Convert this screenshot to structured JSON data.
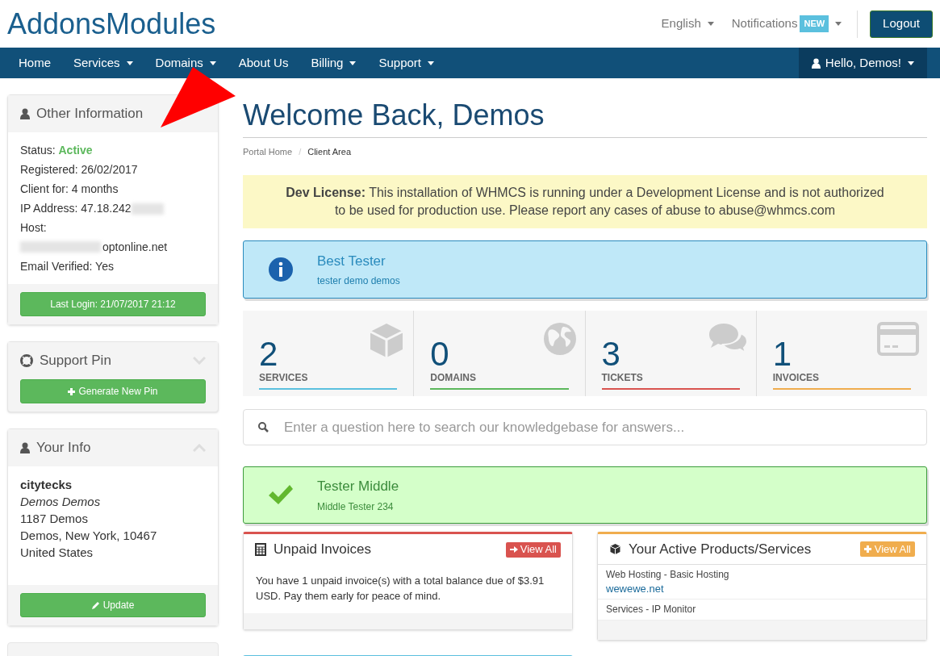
{
  "header": {
    "logo": "AddonsModules",
    "language": "English",
    "notifications": {
      "label": "Notifications",
      "badge": "NEW"
    },
    "logout": "Logout"
  },
  "nav": {
    "items": [
      {
        "label": "Home",
        "dropdown": false
      },
      {
        "label": "Services",
        "dropdown": true
      },
      {
        "label": "Domains",
        "dropdown": true
      },
      {
        "label": "About Us",
        "dropdown": false
      },
      {
        "label": "Billing",
        "dropdown": true
      },
      {
        "label": "Support",
        "dropdown": true
      }
    ],
    "user_menu": "Hello, Demos!"
  },
  "sidebar": {
    "other_information": {
      "title": "Other Information",
      "lines": [
        {
          "kind": "status",
          "label": "Status:",
          "value": "Active"
        },
        {
          "kind": "plain",
          "label": "Registered: 26/02/2017"
        },
        {
          "kind": "plain",
          "label": "Client for: 4 months"
        },
        {
          "kind": "redacted_after",
          "label": "IP Address: 47.18.242"
        },
        {
          "kind": "plain",
          "label": "Host:"
        },
        {
          "kind": "redacted_before",
          "label": "optonline.net"
        },
        {
          "kind": "plain",
          "label": "Email Verified: Yes"
        }
      ],
      "button": "Last Login: 21/07/2017 21:12"
    },
    "support_pin": {
      "title": "Support Pin",
      "collapsed": true,
      "button": "Generate New Pin"
    },
    "your_info": {
      "title": "Your Info",
      "collapsed": false,
      "username": "citytecks",
      "name": "Demos Demos",
      "address": [
        "1187 Demos",
        "Demos, New York, 10467",
        "United States"
      ],
      "button": "Update"
    }
  },
  "main": {
    "title": "Welcome Back, Demos",
    "breadcrumb_separator": "/",
    "breadcrumb": [
      {
        "label": "Portal Home",
        "selected": false
      },
      {
        "label": "Client Area",
        "selected": true
      }
    ],
    "license_alert": "**Dev License:** This installation of WHMCS is running under a Development License and is not authorized to be used for production use. Please report any cases of abuse to abuse@whmcs.com",
    "info_banner": {
      "title": "Best Tester",
      "subtitle": "tester demo demos"
    },
    "stats": [
      {
        "kind": "box",
        "count": "2",
        "label": "SERVICES",
        "color": "#5bc0de"
      },
      {
        "kind": "globe",
        "count": "0",
        "label": "DOMAINS",
        "color": "#5cb85c"
      },
      {
        "kind": "chat",
        "count": "3",
        "label": "TICKETS",
        "color": "#d9534f"
      },
      {
        "kind": "card",
        "count": "1",
        "label": "INVOICES",
        "color": "#f0ad4e"
      }
    ],
    "search": {
      "placeholder": "Enter a question here to search our knowledgebase for answers..."
    },
    "success_banner": {
      "title": "Tester Middle",
      "subtitle": "Middle Tester 234"
    },
    "unpaid_invoices": {
      "title": "Unpaid Invoices",
      "button": "View All",
      "text": "You have 1 unpaid invoice(s) with a total balance due of $3.91 USD. Pay them early for peace of mind."
    },
    "active_products": {
      "title": "Your Active Products/Services",
      "button": "View All",
      "items": [
        {
          "label": "Web Hosting - Basic Hosting",
          "link": "wewewe.net"
        },
        {
          "label": "Services - IP Monitor"
        }
      ]
    }
  }
}
